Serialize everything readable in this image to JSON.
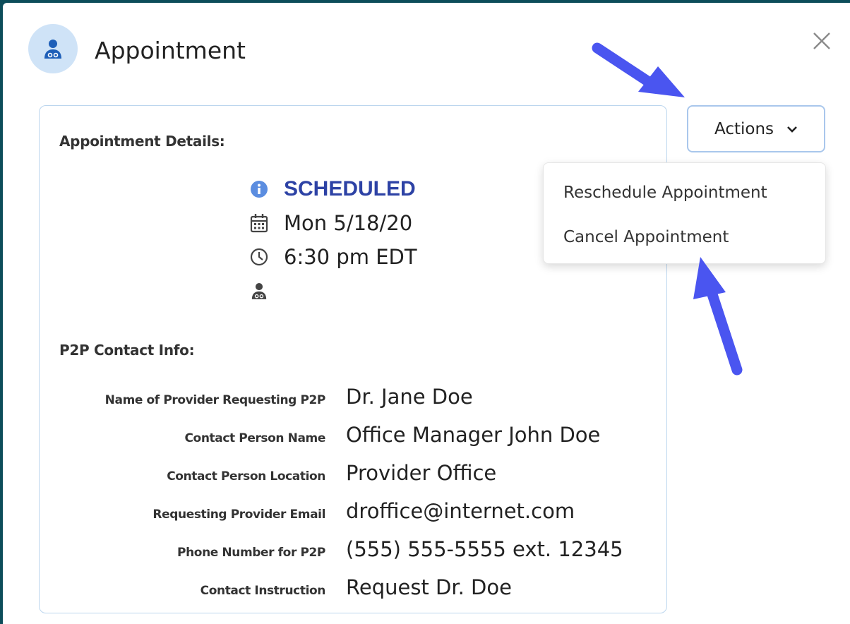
{
  "header": {
    "title": "Appointment",
    "icon": "doctor-icon"
  },
  "details": {
    "heading": "Appointment Details:",
    "status": "SCHEDULED",
    "date": "Mon 5/18/20",
    "time": "6:30 pm EDT",
    "status_color": "#2d42a5"
  },
  "contact": {
    "heading": "P2P Contact Info:",
    "rows": [
      {
        "label": "Name of Provider Requesting P2P",
        "value": "Dr. Jane Doe"
      },
      {
        "label": "Contact Person Name",
        "value": "Office Manager John Doe"
      },
      {
        "label": "Contact Person Location",
        "value": "Provider Office"
      },
      {
        "label": "Requesting Provider Email",
        "value": "droffice@internet.com"
      },
      {
        "label": "Phone Number for P2P",
        "value": "(555) 555-5555 ext. 12345"
      },
      {
        "label": "Contact Instruction",
        "value": "Request Dr. Doe"
      }
    ]
  },
  "actions": {
    "label": "Actions",
    "menu": [
      {
        "label": "Reschedule Appointment"
      },
      {
        "label": "Cancel Appointment"
      }
    ]
  },
  "colors": {
    "accent": "#1e5fb8",
    "annotation_arrow": "#4a55f0",
    "backdrop": "#0d4d5a"
  }
}
